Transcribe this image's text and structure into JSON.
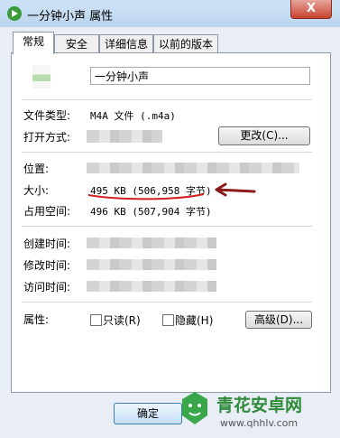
{
  "window": {
    "title": "一分钟小声 属性",
    "close_glyph": "X"
  },
  "tabs": [
    {
      "label": "常规"
    },
    {
      "label": "安全"
    },
    {
      "label": "详细信息"
    },
    {
      "label": "以前的版本"
    }
  ],
  "general": {
    "file_name": "一分钟小声",
    "type_label": "文件类型:",
    "type_value": "M4A 文件 (.m4a)",
    "open_with_label": "打开方式:",
    "change_button": "更改(C)...",
    "location_label": "位置:",
    "size_label": "大小:",
    "size_value": "495 KB (506,958 字节)",
    "disk_size_label": "占用空间:",
    "disk_size_value": "496 KB (507,904 字节)",
    "created_label": "创建时间:",
    "modified_label": "修改时间:",
    "accessed_label": "访问时间:",
    "attributes_label": "属性:",
    "readonly_label": "只读(R)",
    "hidden_label": "隐藏(H)",
    "advanced_button": "高级(D)..."
  },
  "footer": {
    "ok_button": "确定"
  },
  "watermark": {
    "title": "青花安卓网",
    "url": "www.qhhlv.com"
  },
  "colors": {
    "annotation_red": "#d22020",
    "annotation_arrow": "#8b1a1a",
    "watermark_green": "#2e8b3a"
  }
}
